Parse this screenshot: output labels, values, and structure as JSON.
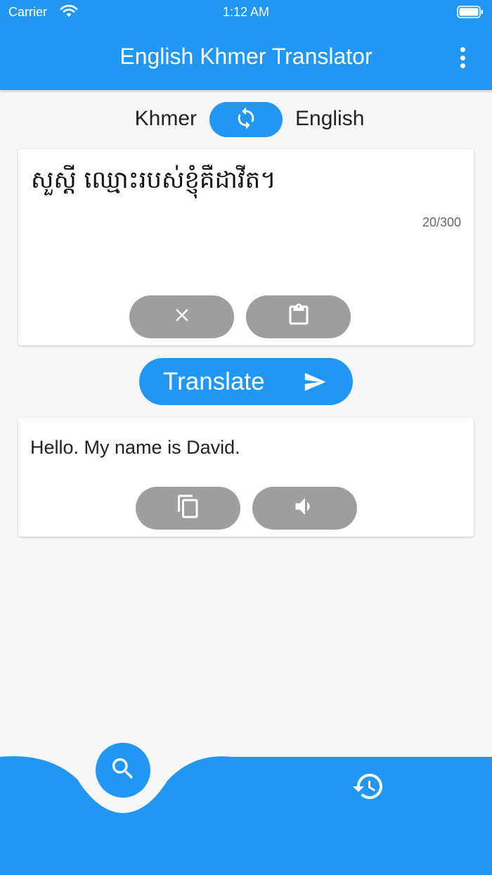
{
  "status_bar": {
    "carrier": "Carrier",
    "time": "1:12 AM"
  },
  "app_bar": {
    "title": "English Khmer Translator"
  },
  "languages": {
    "source": "Khmer",
    "target": "English"
  },
  "input": {
    "text": "សួស្តី ឈ្មោះរបស់ខ្ញុំគឺដាវីត។",
    "char_count": "20/300"
  },
  "translate_button": {
    "label": "Translate"
  },
  "output": {
    "text": "Hello. My name is David."
  },
  "icons": {
    "menu": "more-vertical-icon",
    "swap": "swap-languages-icon",
    "clear": "close-icon",
    "paste": "clipboard-icon",
    "send": "send-icon",
    "copy": "copy-icon",
    "speak": "volume-icon",
    "search": "search-icon",
    "history": "history-icon"
  },
  "colors": {
    "primary": "#2196f3",
    "button_gray": "#9e9e9e",
    "background": "#f7f7f7"
  }
}
